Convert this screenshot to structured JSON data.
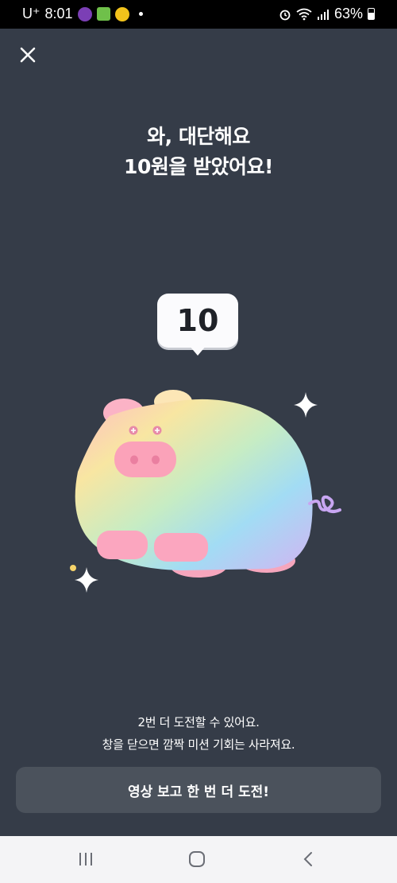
{
  "status_bar": {
    "carrier": "U⁺",
    "time": "8:01",
    "battery": "63%",
    "app_icons": [
      "kurly-icon",
      "notes-icon",
      "kakao-dot-icon"
    ],
    "status_icons": [
      "alarm-icon",
      "wifi-icon",
      "signal-icon",
      "battery-icon"
    ]
  },
  "header": {
    "close_icon": "close-icon"
  },
  "reward": {
    "title_line1": "와, 대단해요",
    "title_line2": "10원을 받았어요!",
    "amount": "10"
  },
  "illustration": {
    "name": "rainbow-pig",
    "colors": {
      "background": "#353c48",
      "pig_pink": "#f8a8c0",
      "gradient": [
        "#ffc8a8",
        "#f6e6a0",
        "#bde8c8",
        "#a4d8f2",
        "#d6b8f0"
      ]
    }
  },
  "message": {
    "line1": "2번 더 도전할 수 있어요.",
    "line2": "창을 닫으면 깜짝 미션 기회는 사라져요."
  },
  "action_button": {
    "label": "영상 보고 한 번 더 도전!"
  },
  "nav_bar": {
    "items": [
      "recent-apps-icon",
      "home-icon",
      "back-icon"
    ]
  }
}
